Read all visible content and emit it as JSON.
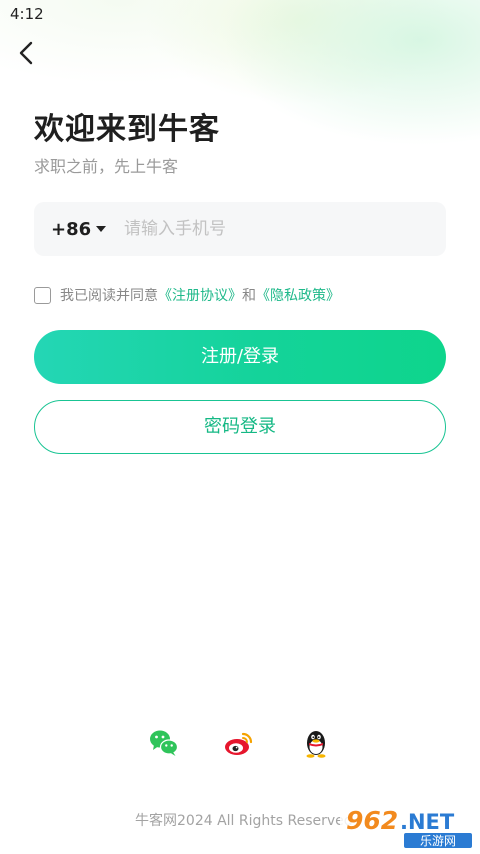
{
  "status_bar": {
    "time": "4:12"
  },
  "header": {
    "back_icon": "chevron-left-icon"
  },
  "title": "欢迎来到牛客",
  "subtitle": "求职之前，先上牛客",
  "phone": {
    "country_code": "+86",
    "placeholder": "请输入手机号",
    "value": ""
  },
  "agreement": {
    "prefix": "我已阅读并同意",
    "terms": "《注册协议》",
    "conjunction": "和",
    "privacy": "《隐私政策》"
  },
  "buttons": {
    "primary": "注册/登录",
    "secondary": "密码登录"
  },
  "social": [
    {
      "icon": "wechat-icon"
    },
    {
      "icon": "weibo-icon"
    },
    {
      "icon": "qq-icon"
    }
  ],
  "footer": "牛客网2024 All Rights Reserved",
  "watermark": {
    "logo": "962.NET",
    "text": "乐游网"
  },
  "colors": {
    "accent": "#14d39a",
    "accent_dark": "#14b884",
    "link": "#1fb98a"
  }
}
